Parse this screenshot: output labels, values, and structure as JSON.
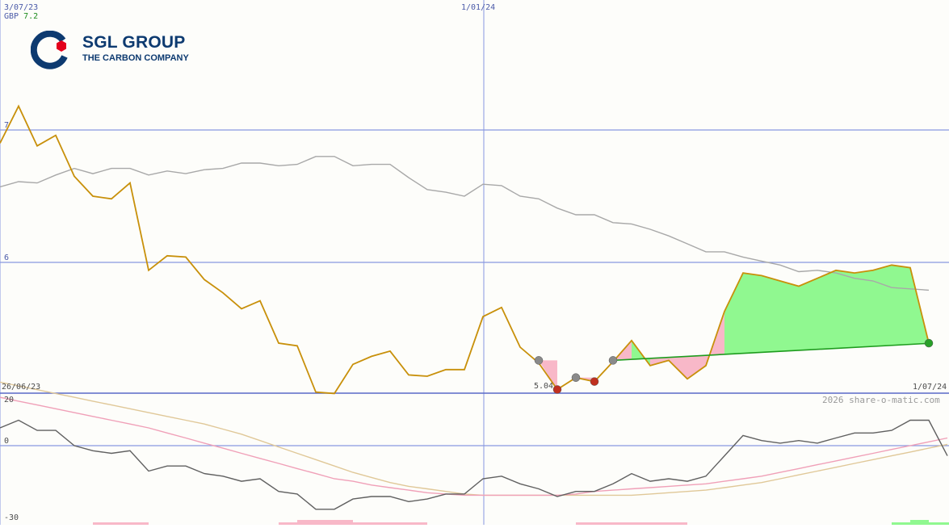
{
  "header": {
    "start_date": "3/07/23",
    "currency": "GBP",
    "last_price": "7.2"
  },
  "logo": {
    "brand": "SGL GROUP",
    "tagline": "THE CARBON COMPANY",
    "colors": {
      "navy": "#0d3a70",
      "red": "#e3001b"
    }
  },
  "footer": {
    "lower_start_date": "26/06/23",
    "end_date": "1/07/24",
    "copyright": "2026 share-o-matic.com"
  },
  "annotation": {
    "low_value": "5.04"
  },
  "colors": {
    "price": "#c8900a",
    "average": "#a8a8a8",
    "trend": "#1e9c1e",
    "gain_fill": "#90f890",
    "loss_fill": "#f8b8c8",
    "grid": "#8898e0",
    "momentum": "#606060",
    "signal_pink": "#f0a0b8",
    "signal_tan": "#e0c898"
  },
  "chart_data": [
    {
      "type": "line",
      "name": "price",
      "x_ticks": [
        {
          "label": "3/07/23",
          "index": 0
        },
        {
          "label": "1/01/24",
          "index": 26
        }
      ],
      "y_ticks": [
        {
          "label": "7",
          "value": 7
        },
        {
          "label": "6",
          "value": 6
        }
      ],
      "ylim": [
        5,
        7.2
      ],
      "grid": true,
      "series": [
        {
          "key": "price",
          "values": [
            6.9,
            7.18,
            6.88,
            6.96,
            6.65,
            6.5,
            6.48,
            6.6,
            5.94,
            6.05,
            6.04,
            5.87,
            5.77,
            5.65,
            5.71,
            5.39,
            5.37,
            5.02,
            5.01,
            5.23,
            5.29,
            5.33,
            5.15,
            5.14,
            5.19,
            5.19,
            5.59,
            5.66,
            5.36,
            5.24,
            5.04,
            5.13,
            5.1,
            5.25,
            5.41,
            5.22,
            5.26,
            5.12,
            5.22,
            5.63,
            5.92,
            5.9,
            5.86,
            5.82,
            5.88,
            5.94,
            5.92,
            5.94,
            5.98,
            5.96,
            5.39
          ]
        },
        {
          "key": "average",
          "values": [
            6.57,
            6.61,
            6.6,
            6.66,
            6.71,
            6.67,
            6.71,
            6.71,
            6.66,
            6.69,
            6.67,
            6.7,
            6.71,
            6.75,
            6.75,
            6.73,
            6.74,
            6.8,
            6.8,
            6.73,
            6.74,
            6.74,
            6.64,
            6.55,
            6.53,
            6.5,
            6.59,
            6.58,
            6.5,
            6.48,
            6.41,
            6.36,
            6.36,
            6.3,
            6.29,
            6.25,
            6.2,
            6.14,
            6.08,
            6.08,
            6.04,
            6.01,
            5.98,
            5.93,
            5.94,
            5.92,
            5.88,
            5.86,
            5.81,
            5.8,
            5.79
          ]
        }
      ],
      "trend_line": {
        "from_index": 33,
        "from_value": 5.26,
        "to_index": 50,
        "to_value": 5.39
      },
      "markers": [
        {
          "index": 29,
          "value": 5.26,
          "kind": "grey"
        },
        {
          "index": 30,
          "value": 5.04,
          "kind": "red"
        },
        {
          "index": 31,
          "value": 5.13,
          "kind": "grey"
        },
        {
          "index": 32,
          "value": 5.1,
          "kind": "red"
        },
        {
          "index": 33,
          "value": 5.26,
          "kind": "grey"
        },
        {
          "index": 50,
          "value": 5.39,
          "kind": "green"
        }
      ]
    },
    {
      "type": "line",
      "name": "momentum",
      "y_ticks": [
        {
          "label": "20",
          "value": 20
        },
        {
          "label": "0",
          "value": 0
        },
        {
          "label": "-30",
          "value": -30
        }
      ],
      "ylim": [
        -30,
        20
      ],
      "series": [
        {
          "key": "oscillator",
          "values": [
            7,
            10,
            6,
            6,
            0,
            -2,
            -3,
            -2,
            -10,
            -8,
            -8,
            -11,
            -12,
            -14,
            -13,
            -18,
            -19,
            -25,
            -25,
            -21,
            -20,
            -20,
            -22,
            -21,
            -19,
            -19,
            -13,
            -12,
            -15,
            -17,
            -20,
            -18,
            -18,
            -15,
            -11,
            -14,
            -13,
            -14,
            -12,
            -4,
            4,
            2,
            1,
            2,
            1,
            3,
            5,
            5,
            6,
            10,
            10,
            -4
          ]
        },
        {
          "key": "signal_pink",
          "values": [
            19,
            17.5,
            16,
            14.5,
            13,
            11.5,
            10,
            8.5,
            7,
            5,
            3,
            1,
            -1,
            -3,
            -5,
            -7,
            -9,
            -11,
            -13,
            -14,
            -15.5,
            -16.5,
            -17.5,
            -18.5,
            -19,
            -19.5,
            -19.5,
            -19.5,
            -19.5,
            -19.5,
            -19.5,
            -19,
            -18,
            -17.5,
            -17,
            -16.5,
            -16,
            -15.5,
            -15,
            -14,
            -13,
            -12,
            -10.5,
            -9,
            -7.5,
            -6,
            -4.5,
            -3,
            -1.5,
            0,
            1.5,
            3
          ]
        },
        {
          "key": "signal_tan",
          "values": [
            25,
            23.5,
            22,
            20.5,
            19,
            17.5,
            16,
            14.5,
            13,
            11.5,
            10,
            8.5,
            6.5,
            4.5,
            2,
            -0.5,
            -3,
            -5.5,
            -8,
            -10.5,
            -12.5,
            -14.5,
            -16,
            -17,
            -18,
            -19,
            -19.5,
            -19.5,
            -19.5,
            -19.5,
            -19.5,
            -19.5,
            -19.5,
            -19.5,
            -19.5,
            -19,
            -18.5,
            -18,
            -17.5,
            -16.5,
            -15.5,
            -14.5,
            -13,
            -11.5,
            -10,
            -8.5,
            -7,
            -5.5,
            -4,
            -2.5,
            -1,
            0.5
          ]
        }
      ],
      "histogram": [
        {
          "from_index": 5,
          "to_index": 8,
          "level": 1,
          "kind": "loss"
        },
        {
          "from_index": 15,
          "to_index": 16,
          "level": 1,
          "kind": "loss"
        },
        {
          "from_index": 16,
          "to_index": 19,
          "level": 2,
          "kind": "loss"
        },
        {
          "from_index": 19,
          "to_index": 23,
          "level": 1,
          "kind": "loss"
        },
        {
          "from_index": 31,
          "to_index": 37,
          "level": 1,
          "kind": "loss"
        },
        {
          "from_index": 48,
          "to_index": 49,
          "level": 1,
          "kind": "gain"
        },
        {
          "from_index": 49,
          "to_index": 50,
          "level": 2,
          "kind": "gain"
        },
        {
          "from_index": 50,
          "to_index": 52,
          "level": 1,
          "kind": "gain"
        }
      ]
    }
  ]
}
